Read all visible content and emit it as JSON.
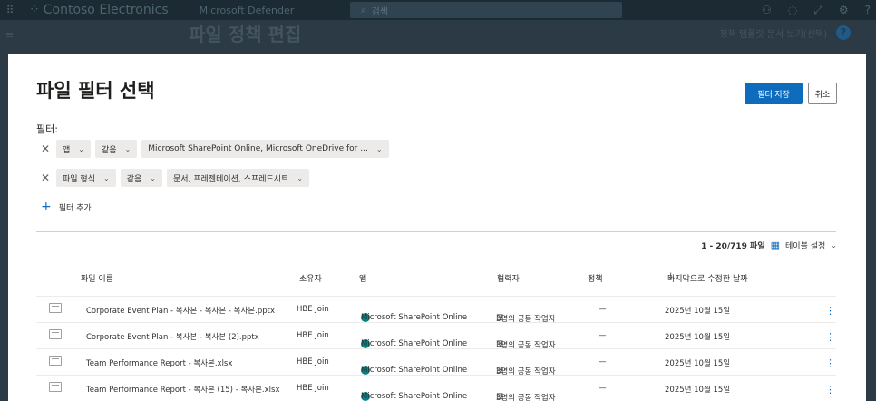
{
  "topbar": {
    "brand": "Contoso Electronics",
    "product": "Microsoft Defender",
    "search_placeholder": "검색",
    "icons": [
      "waffle-icon",
      "brand-dots-icon",
      "search-icon",
      "people-icon",
      "help-circle-icon",
      "link-icon",
      "settings-icon",
      "question-icon"
    ]
  },
  "behind": {
    "title": "파일 정책 편집",
    "help_text": "정책 템플릿 문서 보기(선택)"
  },
  "dialog": {
    "title": "파일 필터 선택",
    "save_label": "필터 저장",
    "cancel_label": "취소",
    "filter_label": "필터:",
    "filters": [
      {
        "field": "앱",
        "operator": "같음",
        "value": "Microsoft SharePoint Online, Microsoft OneDrive for ..."
      },
      {
        "field": "파일 형식",
        "operator": "같음",
        "value": "문서, 프레젠테이션, 스프레드시트"
      }
    ],
    "add_filter_label": "필터 추가",
    "count_text": "1 - 20/719 파일",
    "table_settings_label": "테이블 설정",
    "columns": {
      "name": "파일 이름",
      "owner": "소유자",
      "app": "앱",
      "collaborators": "협력자",
      "policy": "정책",
      "modified": "마지막으로 수정한 날짜"
    },
    "rows": [
      {
        "name": "Corporate Event Plan - 복사본 - 복사본 - 복사본.pptx",
        "owner": "HBE Join",
        "app": "Microsoft SharePoint Online",
        "collaborators": "3명의 공동 작업자",
        "policy": "—",
        "modified": "2025년 10월 15일"
      },
      {
        "name": "Corporate Event Plan - 복사본 - 복사본 (2).pptx",
        "owner": "HBE Join",
        "app": "Microsoft SharePoint Online",
        "collaborators": "3명의 공동 작업자",
        "policy": "—",
        "modified": "2025년 10월 15일"
      },
      {
        "name": "Team Performance Report - 복사본.xlsx",
        "owner": "HBE Join",
        "app": "Microsoft SharePoint Online",
        "collaborators": "3명의 공동 작업자",
        "policy": "—",
        "modified": "2025년 10월 15일"
      },
      {
        "name": "Team Performance Report - 복사본 (15) - 복사본.xlsx",
        "owner": "HBE Join",
        "app": "Microsoft SharePoint Online",
        "collaborators": "3명의 공동 작업자",
        "policy": "—",
        "modified": "2025년 10월 15일"
      }
    ]
  }
}
